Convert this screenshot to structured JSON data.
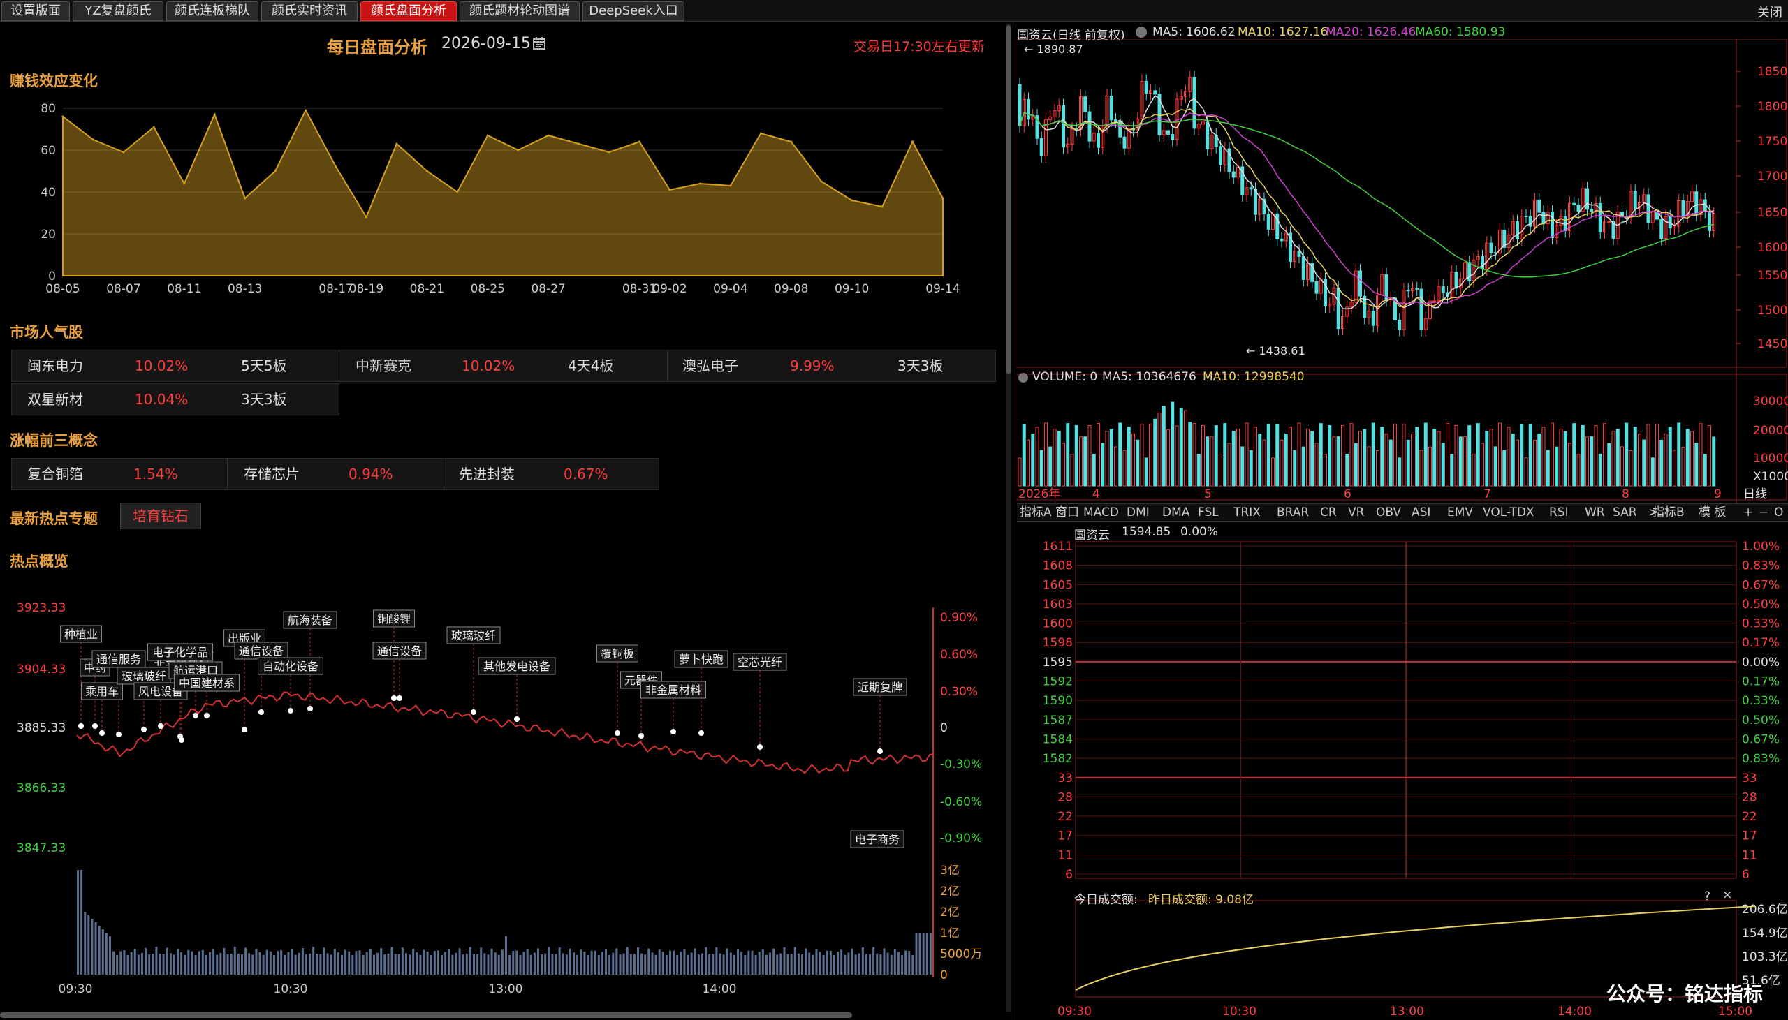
{
  "tabs": [
    "设置版面",
    "YZ复盘颜氏",
    "颜氏连板梯队",
    "颜氏实时资讯",
    "颜氏盘面分析",
    "颜氏题材轮动图谱",
    "DeepSeek入口"
  ],
  "close_label": "关闭",
  "header": {
    "title": "每日盘面分析",
    "date": "2026-09-15",
    "update_note": "交易日17:30左右更新"
  },
  "sections": {
    "money_effect": "赚钱效应变化",
    "popular": "市场人气股",
    "top3": "涨幅前三概念",
    "hot_topic": "最新热点专题",
    "overview": "热点概览"
  },
  "money_effect_chart": {
    "type": "area",
    "x": [
      "08-05",
      "08-06",
      "08-07",
      "08-08",
      "08-11",
      "08-12",
      "08-13",
      "08-14",
      "08-15",
      "08-18",
      "08-19",
      "08-20",
      "08-21",
      "08-22",
      "08-25",
      "08-26",
      "08-27",
      "08-28",
      "08-29",
      "09-01",
      "09-02",
      "09-03",
      "09-04",
      "09-05",
      "09-08",
      "09-09",
      "09-10",
      "09-11",
      "09-12",
      "09-15"
    ],
    "values": [
      76,
      65,
      59,
      71,
      44,
      77,
      37,
      50,
      79,
      52,
      28,
      63,
      50,
      40,
      67,
      60,
      67,
      63,
      59,
      64,
      41,
      44,
      43,
      68,
      64,
      45,
      36,
      33,
      64,
      37
    ],
    "ticks": [
      "08-05",
      "08-07",
      "08-11",
      "08-13",
      "08-17",
      "08-19",
      "08-21",
      "08-25",
      "08-27",
      "08-31",
      "09-02",
      "09-04",
      "09-08",
      "09-10",
      "09-14"
    ],
    "ylim": [
      0,
      80
    ],
    "yticks": [
      "0",
      "20",
      "40",
      "60",
      "80"
    ],
    "color": "#d4a020"
  },
  "popular_stocks": [
    {
      "name": "闽东电力",
      "pct": "10.02%",
      "board": "5天5板"
    },
    {
      "name": "中新赛克",
      "pct": "10.02%",
      "board": "4天4板"
    },
    {
      "name": "澳弘电子",
      "pct": "9.99%",
      "board": "3天3板"
    },
    {
      "name": "双星新材",
      "pct": "10.04%",
      "board": "3天3板"
    }
  ],
  "top_concepts": [
    {
      "name": "复合铜箔",
      "pct": "1.54%"
    },
    {
      "name": "存储芯片",
      "pct": "0.94%"
    },
    {
      "name": "先进封装",
      "pct": "0.67%"
    }
  ],
  "hot_topic_button": "培育钻石",
  "overview_chart": {
    "left_axis": [
      "3923.33",
      "3904.33",
      "3885.33",
      "3866.33",
      "3847.33"
    ],
    "right_axis": [
      "0.90%",
      "0.60%",
      "0.30%",
      "0",
      "-0.30%",
      "-0.60%",
      "-0.90%"
    ],
    "vol_axis": [
      "3亿",
      "2亿",
      "2亿",
      "1亿",
      "5000万",
      "0"
    ],
    "time_axis": [
      "09:30",
      "10:30",
      "13:00",
      "14:00"
    ],
    "labels": [
      "种植业",
      "中药",
      "通信服务",
      "非金属材料",
      "电子化学品",
      "出版业",
      "航海装备",
      "铜酸锂",
      "玻璃玻纤",
      "乘用车",
      "玻璃玻纤",
      "航运港口",
      "通信设备",
      "通信设备",
      "风电设备",
      "中国建材系",
      "自动化设备",
      "其他发电设备",
      "覆铜板",
      "元器件",
      "非金属材料",
      "萝卜快跑",
      "空芯光纤",
      "近期复牌",
      "电子商务"
    ]
  },
  "kline": {
    "title": "国资云(日线 前复权)",
    "ma5": "MA5: 1606.62",
    "ma10": "MA10: 1627.16",
    "ma20": "MA20: 1626.46",
    "ma60": "MA60: 1580.93",
    "high_note": "1890.87",
    "low_note": "1438.61",
    "price_axis": [
      "1850",
      "1800",
      "1750",
      "1700",
      "1650",
      "1600",
      "1550",
      "1500",
      "1450"
    ],
    "volume_title": "VOLUME: 0",
    "vol_ma5": "MA5: 10364676",
    "vol_ma10": "MA10: 12998540",
    "vol_axis": [
      "30000",
      "20000",
      "10000",
      "X1000"
    ],
    "months": [
      "2026年",
      "4",
      "5",
      "6",
      "7",
      "8",
      "9"
    ],
    "period": "日线",
    "indicators": [
      "指标A",
      "窗口",
      "MACD",
      "DMI",
      "DMA",
      "FSL",
      "TRIX",
      "BRAR",
      "CR",
      "VR",
      "OBV",
      "ASI",
      "EMV",
      "VOL-TDX",
      "RSI",
      "WR",
      "SAR",
      ">"
    ],
    "indicator_b": "指标B",
    "template": "模 板",
    "tools": [
      "+",
      "−",
      "O"
    ]
  },
  "intraday": {
    "title": "国资云",
    "price": "1594.85",
    "pct": "0.00%",
    "left_axis": [
      "1611",
      "1608",
      "1605",
      "1603",
      "1600",
      "1598",
      "1595",
      "1592",
      "1590",
      "1587",
      "1584",
      "1582",
      "33",
      "28",
      "22",
      "17",
      "11",
      "6"
    ],
    "right_axis": [
      "1.00%",
      "0.83%",
      "0.67%",
      "0.50%",
      "0.33%",
      "0.17%",
      "0.00%",
      "0.17%",
      "0.33%",
      "0.50%",
      "0.67%",
      "0.83%",
      "33",
      "28",
      "22",
      "17",
      "11",
      "6"
    ],
    "turnover_title": "今日成交额:",
    "yesterday_turnover": "昨日成交额: 9.08亿",
    "turnover_axis": [
      "206.6亿",
      "154.9亿",
      "103.3亿",
      "51.6亿"
    ],
    "time_axis": [
      "09:30",
      "10:30",
      "13:00",
      "14:00",
      "15:00"
    ],
    "help": "?",
    "close": "×"
  },
  "watermark": "公众号：铭达指标"
}
